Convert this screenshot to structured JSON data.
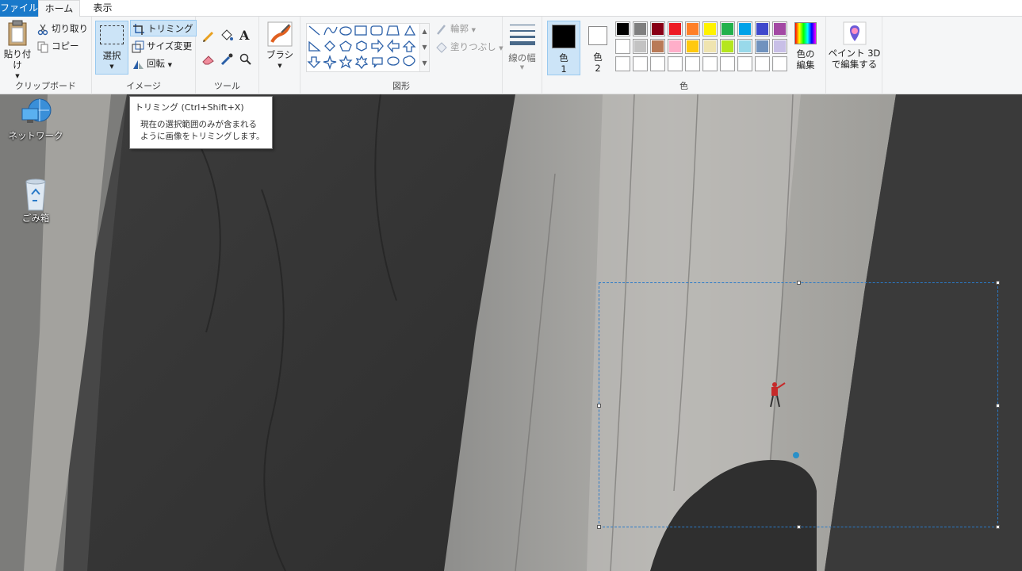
{
  "tabs": {
    "file": "ファイル",
    "home": "ホーム",
    "view": "表示"
  },
  "clipboard": {
    "paste": "貼り付け",
    "cut": "切り取り",
    "copy": "コピー",
    "label": "クリップボード"
  },
  "image": {
    "select": "選択",
    "crop": "トリミング",
    "resize": "サイズ変更",
    "rotate": "回転",
    "label": "イメージ"
  },
  "tools": {
    "label": "ツール",
    "text_glyph": "A"
  },
  "brushes": {
    "label": "ブラシ"
  },
  "shapes": {
    "outline": "輪郭",
    "fill": "塗りつぶし",
    "label": "図形"
  },
  "size": {
    "label": "線の幅"
  },
  "colors": {
    "color1_label": "色",
    "color1_num": "1",
    "color2_label": "色",
    "color2_num": "2",
    "edit_label_1": "色の",
    "edit_label_2": "編集",
    "group_label": "色",
    "color1_value": "#000000",
    "color2_value": "#ffffff",
    "row1": [
      "#000000",
      "#7f7f7f",
      "#880015",
      "#ed1c24",
      "#ff7f27",
      "#fff200",
      "#22b14c",
      "#00a2e8",
      "#3f48cc",
      "#a349a4"
    ],
    "row2": [
      "#ffffff",
      "#c3c3c3",
      "#b97a57",
      "#ffaec9",
      "#ffc90e",
      "#efe4b0",
      "#b5e61d",
      "#99d9ea",
      "#7092be",
      "#c8bfe7"
    ],
    "row3": [
      "#ffffff",
      "#ffffff",
      "#ffffff",
      "#ffffff",
      "#ffffff",
      "#ffffff",
      "#ffffff",
      "#ffffff",
      "#ffffff",
      "#ffffff"
    ]
  },
  "paint3d": {
    "line1": "ペイント 3D",
    "line2": "で編集する"
  },
  "desktop": {
    "network": "ネットワーク",
    "recycle": "ごみ箱"
  },
  "tooltip": {
    "title": "トリミング (Ctrl+Shift+X)",
    "line1": "現在の選択範囲のみが含まれる",
    "line2": "ように画像をトリミングします。"
  }
}
